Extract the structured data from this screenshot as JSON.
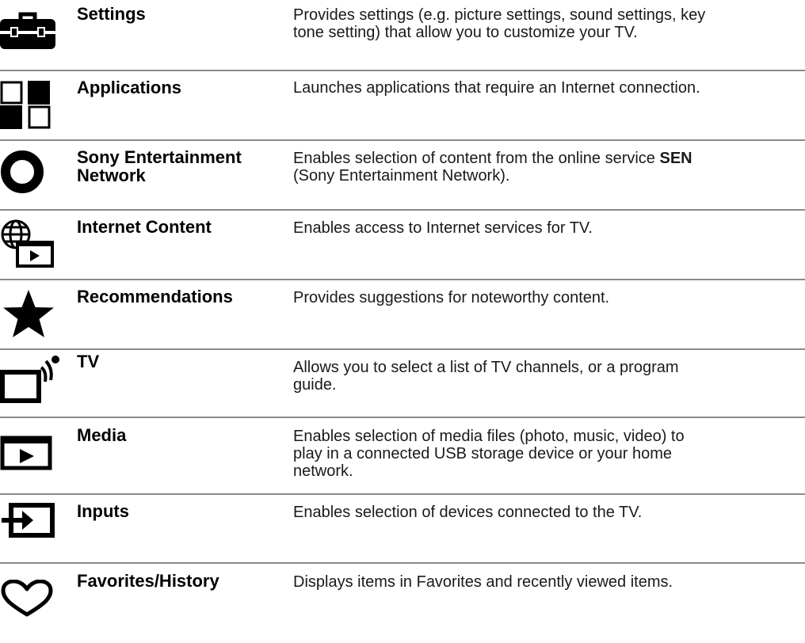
{
  "items": [
    {
      "icon": "toolbox-icon",
      "name": "Settings",
      "desc_lines": [
        "Provides settings (e.g. picture settings, sound settings, key",
        "tone setting) that allow you to customize your TV."
      ]
    },
    {
      "icon": "apps-grid-icon",
      "name": "Applications",
      "desc_lines": [
        "Launches applications that require an Internet connection."
      ]
    },
    {
      "icon": "ring-icon",
      "name_lines": [
        "Sony Entertainment",
        "Network"
      ],
      "desc_pre": "Enables selection of content from the online service ",
      "desc_bold": "SEN",
      "desc_line2": "(Sony Entertainment Network)."
    },
    {
      "icon": "globe-play-icon",
      "name": "Internet Content",
      "desc_lines": [
        "Enables access to Internet services for TV."
      ]
    },
    {
      "icon": "star-icon",
      "name": "Recommendations",
      "desc_lines": [
        "Provides suggestions for noteworthy content."
      ]
    },
    {
      "icon": "tv-icon",
      "name": "TV",
      "desc_lines": [
        "Allows you to select a list of TV channels, or a program",
        "guide."
      ]
    },
    {
      "icon": "media-play-icon",
      "name": "Media",
      "desc_lines": [
        "Enables selection of media files (photo, music, video) to",
        "play in a connected USB storage device or your home",
        "network."
      ]
    },
    {
      "icon": "input-icon",
      "name": "Inputs",
      "desc_lines": [
        "Enables selection of devices connected to the TV."
      ]
    },
    {
      "icon": "heart-icon",
      "name": "Favorites/History",
      "desc_lines": [
        "Displays items in Favorites and recently viewed items."
      ]
    }
  ]
}
